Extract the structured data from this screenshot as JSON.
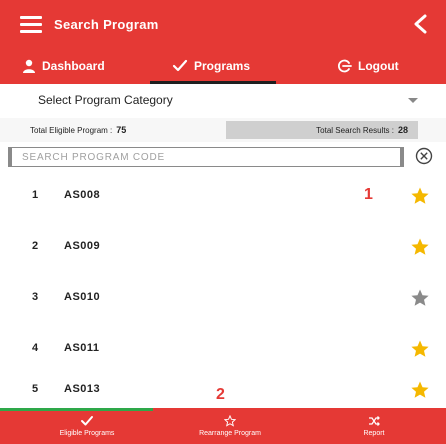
{
  "header": {
    "title": "Search Program",
    "menu_icon": "hamburger-icon",
    "back_icon": "back-chevron-icon"
  },
  "nav": {
    "dashboard": "Dashboard",
    "programs": "Programs",
    "logout": "Logout"
  },
  "category": {
    "placeholder": "Select Program Category"
  },
  "stats": {
    "eligible_label": "Total Eligible Program :",
    "eligible_value": "75",
    "results_label": "Total Search Results :",
    "results_value": "28"
  },
  "search": {
    "placeholder": "SEARCH PROGRAM CODE",
    "value": ""
  },
  "programs": [
    {
      "num": "1",
      "code": "AS008",
      "starred": true
    },
    {
      "num": "2",
      "code": "AS009",
      "starred": true
    },
    {
      "num": "3",
      "code": "AS010",
      "starred": false
    },
    {
      "num": "4",
      "code": "AS011",
      "starred": true
    },
    {
      "num": "5",
      "code": "AS013",
      "starred": true
    }
  ],
  "annotations": [
    "1",
    "2"
  ],
  "tabs": {
    "eligible": "Eligible Programs",
    "rearrange": "Rearrange Program",
    "report": "Report"
  },
  "colors": {
    "primary": "#e53935",
    "star_active": "#f5b800",
    "star_inactive": "#8a8a8a",
    "tab_indicator": "#2ea84a"
  }
}
